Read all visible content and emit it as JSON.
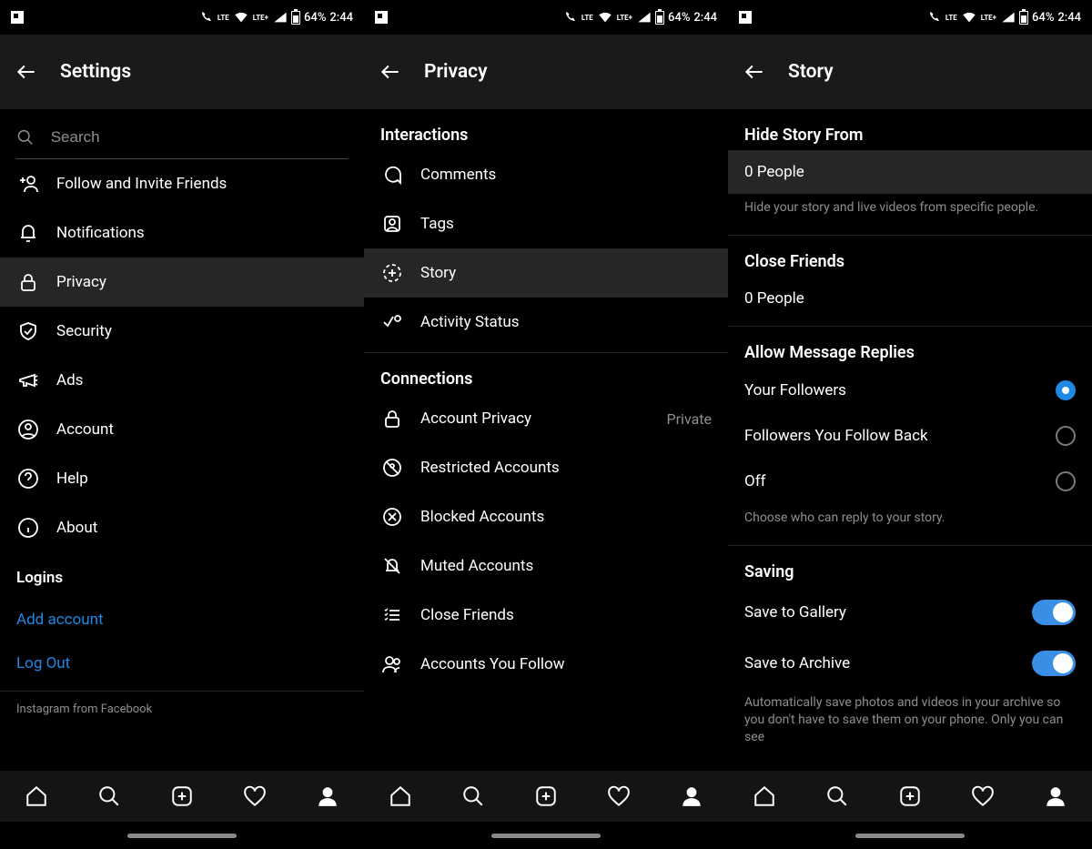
{
  "status": {
    "battery_text": "64%",
    "time": "2:44",
    "net1": "LTE",
    "net2": "LTE+"
  },
  "screen1": {
    "title": "Settings",
    "search_placeholder": "Search",
    "items": [
      {
        "label": "Follow and Invite Friends"
      },
      {
        "label": "Notifications"
      },
      {
        "label": "Privacy",
        "highlighted": true
      },
      {
        "label": "Security"
      },
      {
        "label": "Ads"
      },
      {
        "label": "Account"
      },
      {
        "label": "Help"
      },
      {
        "label": "About"
      }
    ],
    "logins_label": "Logins",
    "add_account": "Add account",
    "log_out": "Log Out",
    "footer": "Instagram from Facebook"
  },
  "screen2": {
    "title": "Privacy",
    "interactions_label": "Interactions",
    "interactions": [
      {
        "label": "Comments"
      },
      {
        "label": "Tags"
      },
      {
        "label": "Story",
        "highlighted": true
      },
      {
        "label": "Activity Status"
      }
    ],
    "connections_label": "Connections",
    "connections": [
      {
        "label": "Account Privacy",
        "trail": "Private"
      },
      {
        "label": "Restricted Accounts"
      },
      {
        "label": "Blocked Accounts"
      },
      {
        "label": "Muted Accounts"
      },
      {
        "label": "Close Friends"
      },
      {
        "label": "Accounts You Follow"
      }
    ]
  },
  "screen3": {
    "title": "Story",
    "hide_label": "Hide Story From",
    "hide_value": "0 People",
    "hide_hint": "Hide your story and live videos from specific people.",
    "close_friends_label": "Close Friends",
    "close_friends_value": "0 People",
    "replies_label": "Allow Message Replies",
    "replies_options": [
      {
        "label": "Your Followers",
        "selected": true
      },
      {
        "label": "Followers You Follow Back",
        "selected": false
      },
      {
        "label": "Off",
        "selected": false
      }
    ],
    "replies_hint": "Choose who can reply to your story.",
    "saving_label": "Saving",
    "save_gallery": "Save to Gallery",
    "save_archive": "Save to Archive",
    "saving_hint": "Automatically save photos and videos in your archive so you don't have to save them on your phone. Only you can see"
  }
}
